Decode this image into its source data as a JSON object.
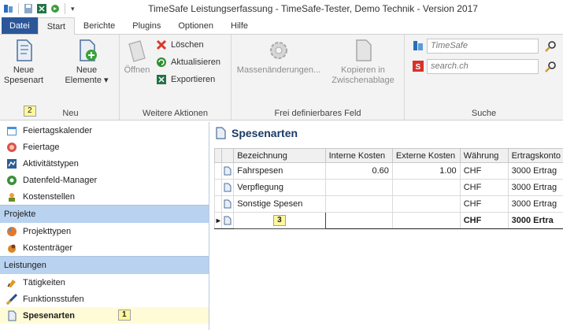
{
  "window": {
    "title": "TimeSafe Leistungserfassung - TimeSafe-Tester, Demo Technik - Version 2017"
  },
  "qat": {
    "dropdown": "▾"
  },
  "tabs": [
    {
      "label": "Datei"
    },
    {
      "label": "Start"
    },
    {
      "label": "Berichte"
    },
    {
      "label": "Plugins"
    },
    {
      "label": "Optionen"
    },
    {
      "label": "Hilfe"
    }
  ],
  "ribbon": {
    "neu": {
      "group_label": "Neu",
      "neue_spesenart": "Neue\nSpesenart",
      "neue_elemente": "Neue\nElemente ▾",
      "keytip": "2"
    },
    "weitere": {
      "group_label": "Weitere Aktionen",
      "oeffnen": "Öffnen",
      "loeschen": "Löschen",
      "aktualisieren": "Aktualisieren",
      "exportieren": "Exportieren"
    },
    "frei": {
      "group_label": "Frei definierbares Feld",
      "massen": "Massenänderungen...",
      "kopieren": "Kopieren in\nZwischenablage"
    },
    "suche": {
      "group_label": "Suche",
      "timesafe_placeholder": "TimeSafe",
      "search_placeholder": "search.ch"
    }
  },
  "nav": {
    "top_items": [
      {
        "label": "Feiertagskalender",
        "icon": "calendar-icon"
      },
      {
        "label": "Feiertage",
        "icon": "holiday-icon"
      },
      {
        "label": "Aktivitätstypen",
        "icon": "activity-icon"
      },
      {
        "label": "Datenfeld-Manager",
        "icon": "datafield-icon"
      },
      {
        "label": "Kostenstellen",
        "icon": "cost-center-icon"
      }
    ],
    "section_projekte": "Projekte",
    "projekte_items": [
      {
        "label": "Projekttypen",
        "icon": "project-type-icon"
      },
      {
        "label": "Kostenträger",
        "icon": "cost-unit-icon"
      }
    ],
    "section_leistungen": "Leistungen",
    "leistungen_items": [
      {
        "label": "Tätigkeiten",
        "icon": "task-icon"
      },
      {
        "label": "Funktionsstufen",
        "icon": "function-level-icon"
      },
      {
        "label": "Spesenarten",
        "icon": "expense-icon"
      }
    ],
    "keytip_selected": "1"
  },
  "main": {
    "title": "Spesenarten",
    "columns": [
      "Bezeichnung",
      "Interne Kosten",
      "Externe Kosten",
      "Währung",
      "Ertragskonto"
    ],
    "rows": [
      {
        "bezeichnung": "Fahrspesen",
        "intern": "0.60",
        "extern": "1.00",
        "waehrung": "CHF",
        "konto": "3000 Ertrag"
      },
      {
        "bezeichnung": "Verpflegung",
        "intern": "",
        "extern": "",
        "waehrung": "CHF",
        "konto": "3000 Ertrag"
      },
      {
        "bezeichnung": "Sonstige Spesen",
        "intern": "",
        "extern": "",
        "waehrung": "CHF",
        "konto": "3000 Ertrag"
      },
      {
        "bezeichnung": "",
        "intern": "",
        "extern": "",
        "waehrung": "CHF",
        "konto": "3000 Ertra"
      }
    ],
    "edit_row_marker": "▸",
    "keytip_edit": "3"
  },
  "colors": {
    "file_tab": "#2b579a",
    "nav_section": "#b8d2ef",
    "selected_row": "#fffbd7",
    "keytip": "#fff79e"
  }
}
